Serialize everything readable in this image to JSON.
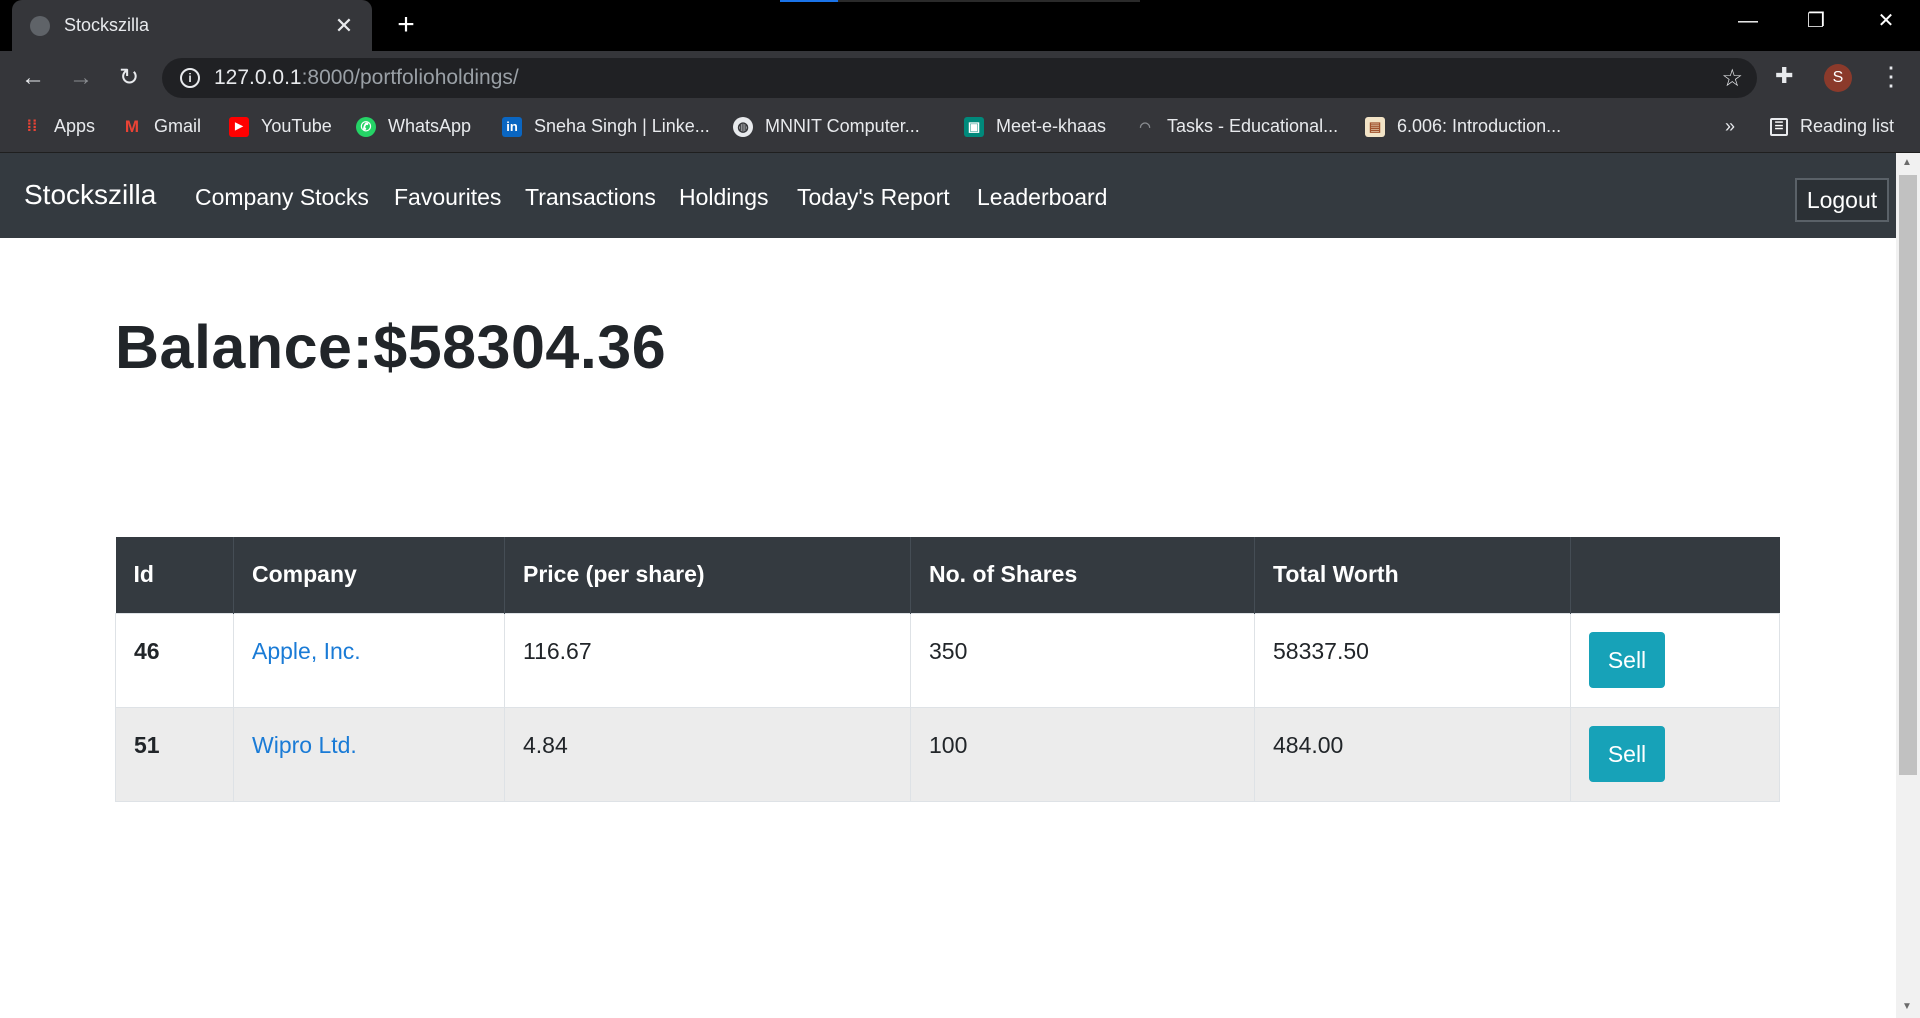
{
  "browser": {
    "tab_title": "Stockszilla",
    "url_host": "127.0.0.1",
    "url_rest": ":8000/portfolioholdings/",
    "loading_progress": 0.16,
    "avatar_letter": "S",
    "bookmarks": [
      {
        "label": "Apps",
        "icon": "apps-grid-icon"
      },
      {
        "label": "Gmail",
        "icon": "gmail-icon"
      },
      {
        "label": "YouTube",
        "icon": "youtube-icon"
      },
      {
        "label": "WhatsApp",
        "icon": "whatsapp-icon"
      },
      {
        "label": "Sneha Singh | Linke...",
        "icon": "linkedin-icon"
      },
      {
        "label": "MNNIT Computer...",
        "icon": "globe-icon"
      },
      {
        "label": "Meet-e-khaas",
        "icon": "meet-icon"
      },
      {
        "label": "Tasks - Educational...",
        "icon": "tasks-icon"
      },
      {
        "label": "6.006: Introduction...",
        "icon": "page-icon"
      }
    ],
    "overflow": "»",
    "reading_list": "Reading list"
  },
  "navbar": {
    "brand": "Stockszilla",
    "links": [
      "Company Stocks",
      "Favourites",
      "Transactions",
      "Holdings",
      "Today's Report",
      "Leaderboard"
    ],
    "logout": "Logout"
  },
  "balance": "Balance:$58304.36",
  "table": {
    "headers": [
      "Id",
      "Company",
      "Price (per share)",
      "No. of Shares",
      "Total Worth",
      ""
    ],
    "rows": [
      {
        "id": "46",
        "company": "Apple, Inc.",
        "price": "116.67",
        "shares": "350",
        "worth": "58337.50",
        "action": "Sell"
      },
      {
        "id": "51",
        "company": "Wipro Ltd.",
        "price": "4.84",
        "shares": "100",
        "worth": "484.00",
        "action": "Sell"
      }
    ]
  }
}
